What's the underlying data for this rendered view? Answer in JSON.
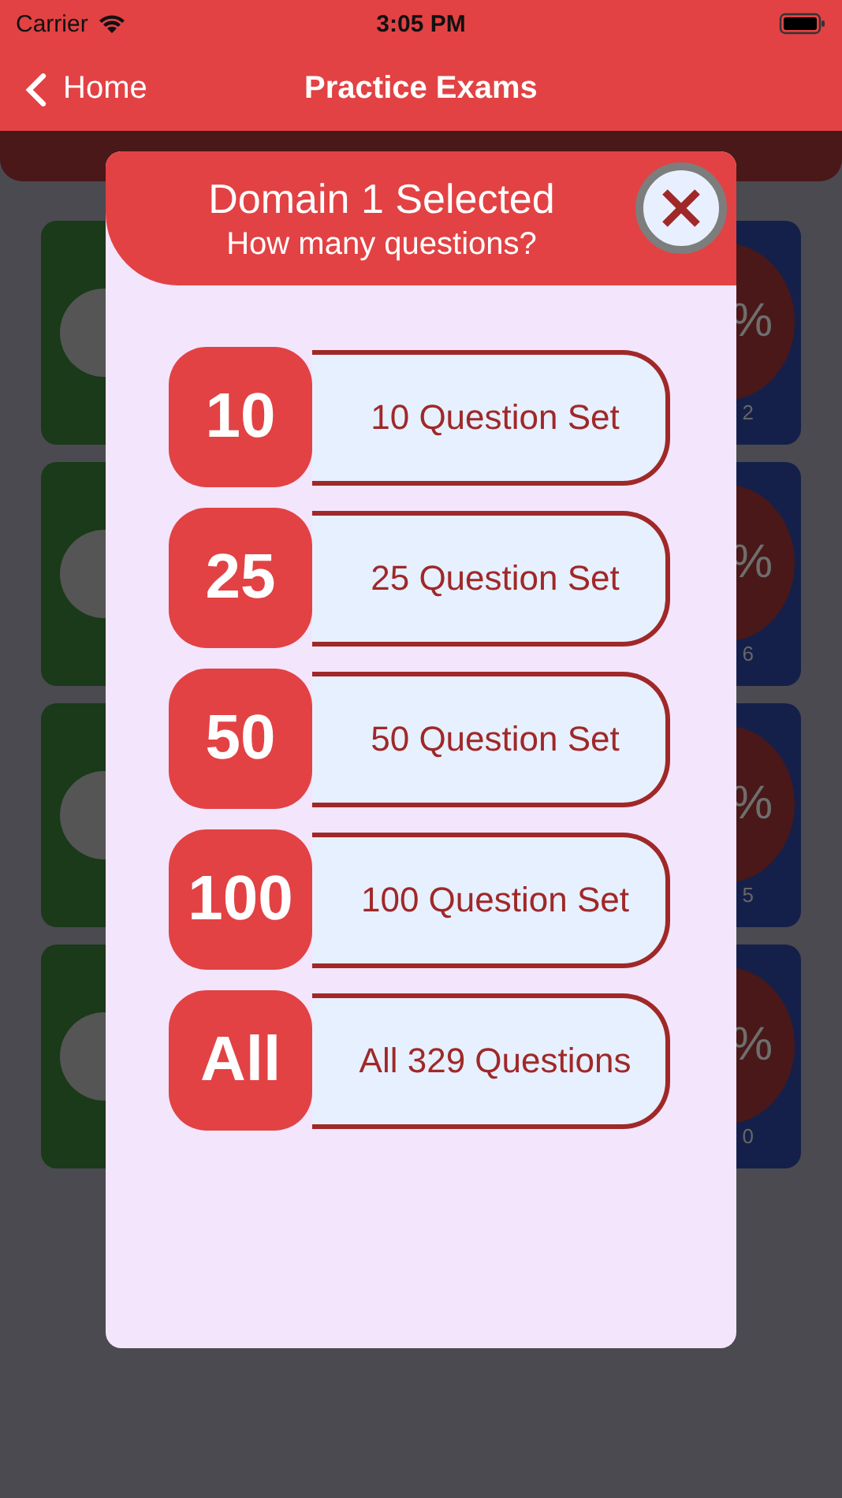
{
  "status_bar": {
    "carrier": "Carrier",
    "time": "3:05 PM"
  },
  "nav_bar": {
    "back": "Home",
    "title": "Practice Exams"
  },
  "page": {
    "domains": [
      {
        "percent": "%",
        "reading": "2"
      },
      {
        "percent": "%",
        "reading": "6"
      },
      {
        "percent": "%",
        "reading": "5"
      },
      {
        "percent": "%",
        "reading": "0"
      }
    ]
  },
  "dialog": {
    "title": "Domain 1 Selected",
    "subtitle": "How many questions?",
    "options": [
      {
        "badge": "10",
        "label": "10 Question Set"
      },
      {
        "badge": "25",
        "label": "25 Question Set"
      },
      {
        "badge": "50",
        "label": "50 Question Set"
      },
      {
        "badge": "100",
        "label": "100 Question Set"
      },
      {
        "badge": "All",
        "label": "All 329 Questions"
      }
    ]
  }
}
